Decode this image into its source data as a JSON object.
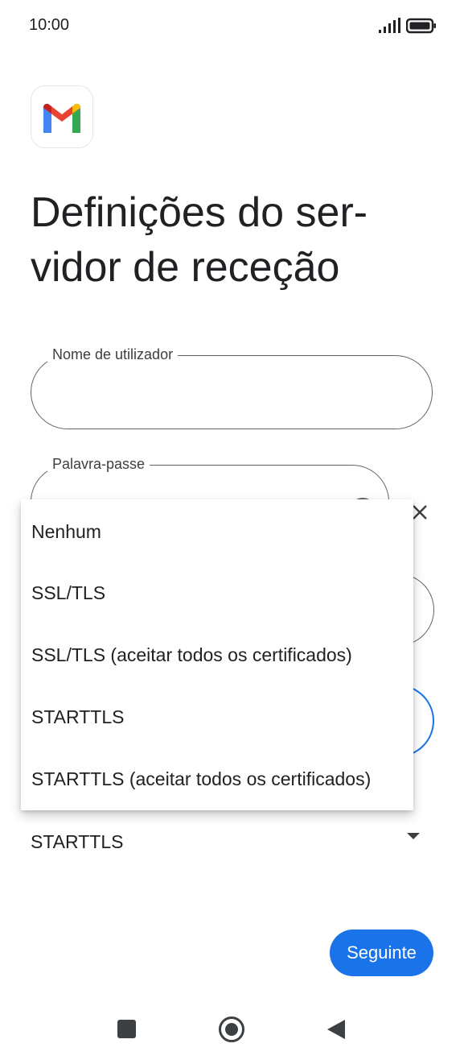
{
  "status_bar": {
    "time": "10:00",
    "signal_icon": "signal-icon",
    "battery_icon": "battery-icon"
  },
  "app": {
    "logo_icon": "gmail-logo-icon"
  },
  "page": {
    "title": "Definições do ser-vidor de receção"
  },
  "form": {
    "username": {
      "label": "Nome de utilizador",
      "value": ""
    },
    "password": {
      "label": "Palavra-passe",
      "value": ""
    },
    "security_type": {
      "selected": "STARTTLS"
    }
  },
  "dropdown": {
    "options": [
      "Nenhum",
      "SSL/TLS",
      "SSL/TLS (aceitar todos os certificados)",
      "STARTTLS",
      "STARTTLS (aceitar todos os certificados)"
    ]
  },
  "actions": {
    "next_label": "Seguinte"
  },
  "colors": {
    "primary": "#1a73e8",
    "text": "#202124",
    "outline": "#5f6368"
  },
  "nav_bar": {
    "recents_icon": "square-icon",
    "home_icon": "circle-icon",
    "back_icon": "triangle-back-icon"
  }
}
